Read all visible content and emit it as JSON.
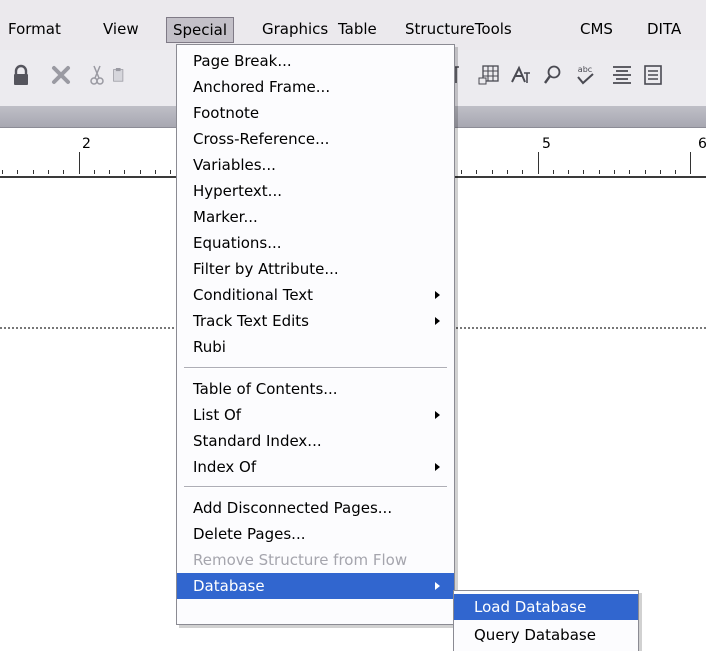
{
  "menubar": {
    "items": [
      "Format",
      "View",
      "Special",
      "Graphics",
      "Table",
      "StructureTools",
      "CMS",
      "DITA"
    ],
    "active": "Special"
  },
  "toolbar": {
    "icons": [
      "lock-icon",
      "delete-icon",
      "cut-icon",
      "paste-icon",
      "paragraph-mark-icon",
      "table-icon",
      "font-icon",
      "search-icon",
      "spellcheck-icon",
      "align-center-icon",
      "document-icon"
    ],
    "spellcheck_glyph": "abc"
  },
  "ruler": {
    "labels": [
      "2",
      "5",
      "6"
    ]
  },
  "special_menu": {
    "groups": [
      {
        "items": [
          {
            "label": "Page Break...",
            "submenu": false,
            "disabled": false
          },
          {
            "label": "Anchored Frame...",
            "submenu": false,
            "disabled": false
          },
          {
            "label": "Footnote",
            "submenu": false,
            "disabled": false
          },
          {
            "label": "Cross-Reference...",
            "submenu": false,
            "disabled": false
          },
          {
            "label": "Variables...",
            "submenu": false,
            "disabled": false
          },
          {
            "label": "Hypertext...",
            "submenu": false,
            "disabled": false
          },
          {
            "label": "Marker...",
            "submenu": false,
            "disabled": false
          },
          {
            "label": "Equations...",
            "submenu": false,
            "disabled": false
          },
          {
            "label": "Filter by Attribute...",
            "submenu": false,
            "disabled": false
          },
          {
            "label": "Conditional Text",
            "submenu": true,
            "disabled": false
          },
          {
            "label": "Track Text Edits",
            "submenu": true,
            "disabled": false
          },
          {
            "label": "Rubi",
            "submenu": false,
            "disabled": false
          }
        ]
      },
      {
        "items": [
          {
            "label": "Table of Contents...",
            "submenu": false,
            "disabled": false
          },
          {
            "label": "List Of",
            "submenu": true,
            "disabled": false
          },
          {
            "label": "Standard Index...",
            "submenu": false,
            "disabled": false
          },
          {
            "label": "Index Of",
            "submenu": true,
            "disabled": false
          }
        ]
      },
      {
        "items": [
          {
            "label": "Add Disconnected Pages...",
            "submenu": false,
            "disabled": false
          },
          {
            "label": "Delete Pages...",
            "submenu": false,
            "disabled": false
          },
          {
            "label": "Remove Structure from Flow",
            "submenu": false,
            "disabled": true
          },
          {
            "label": "Database",
            "submenu": true,
            "disabled": false,
            "highlighted": true
          }
        ]
      }
    ]
  },
  "database_submenu": {
    "items": [
      {
        "label": "Load Database",
        "highlighted": true
      },
      {
        "label": "Query Database",
        "highlighted": false
      }
    ]
  },
  "colors": {
    "highlight": "#3166cf",
    "menu_background": "#fcfcfe",
    "disabled_text": "#a5a5ad"
  }
}
